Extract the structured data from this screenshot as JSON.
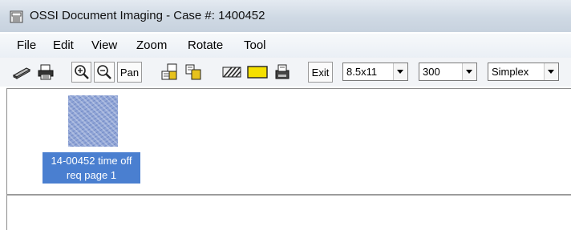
{
  "window": {
    "title": "OSSI Document Imaging - Case #: 1400452",
    "icon": "scanner-app-icon"
  },
  "menubar": {
    "items": [
      "File",
      "Edit",
      "View",
      "Zoom",
      "Rotate",
      "Tool"
    ]
  },
  "toolbar": {
    "icons": [
      "scanner-icon",
      "print-icon",
      "zoom-in-icon",
      "zoom-out-icon",
      "pan",
      "tile-pages-icon",
      "copy-pages-icon",
      "shading-icon",
      "highlight-box-icon",
      "clear-icon"
    ],
    "pan_label": "Pan",
    "exit_label": "Exit",
    "page_size": "8.5x11",
    "resolution": "300",
    "duplex_mode": "Simplex",
    "highlight_color": "#f5e000"
  },
  "documents": [
    {
      "caption_line1": "14-00452 time off",
      "caption_line2": "req page 1",
      "selection_color": "#4a7fd0"
    }
  ]
}
